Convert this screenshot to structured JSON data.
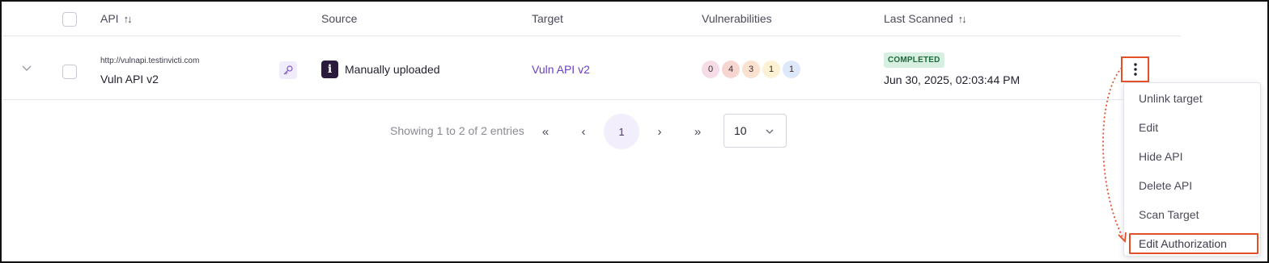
{
  "table": {
    "columns": {
      "api": "API",
      "source": "Source",
      "target": "Target",
      "vulnerabilities": "Vulnerabilities",
      "last_scanned": "Last Scanned"
    },
    "rows": [
      {
        "api_url": "http://vulnapi.testinvicti.com",
        "api_name": "Vuln API v2",
        "source": "Manually uploaded",
        "source_icon_letter": "i",
        "target": "Vuln API v2",
        "vulnerabilities": [
          {
            "count": "0",
            "color": "#f6dce6"
          },
          {
            "count": "4",
            "color": "#f8d6d0"
          },
          {
            "count": "3",
            "color": "#fbe1cf"
          },
          {
            "count": "1",
            "color": "#fdf1d3"
          },
          {
            "count": "1",
            "color": "#dde8fb"
          }
        ],
        "status": "COMPLETED",
        "last_scanned": "Jun 30, 2025, 02:03:44 PM"
      }
    ]
  },
  "pagination": {
    "info": "Showing 1 to 2 of 2 entries",
    "first": "«",
    "prev": "‹",
    "current_page": "1",
    "next": "›",
    "last": "»",
    "page_size": "10"
  },
  "actions_menu": {
    "items": [
      "Unlink target",
      "Edit",
      "Hide API",
      "Delete API",
      "Scan Target",
      "Edit Authorization"
    ]
  },
  "colors": {
    "accent": "#6b3fc4",
    "highlight": "#e2502a",
    "status_bg": "#d7efe0"
  },
  "icons": {
    "sort": "sort-icon",
    "expand": "chevron-down-icon",
    "key": "key-icon",
    "kebab": "more-vertical-icon"
  }
}
